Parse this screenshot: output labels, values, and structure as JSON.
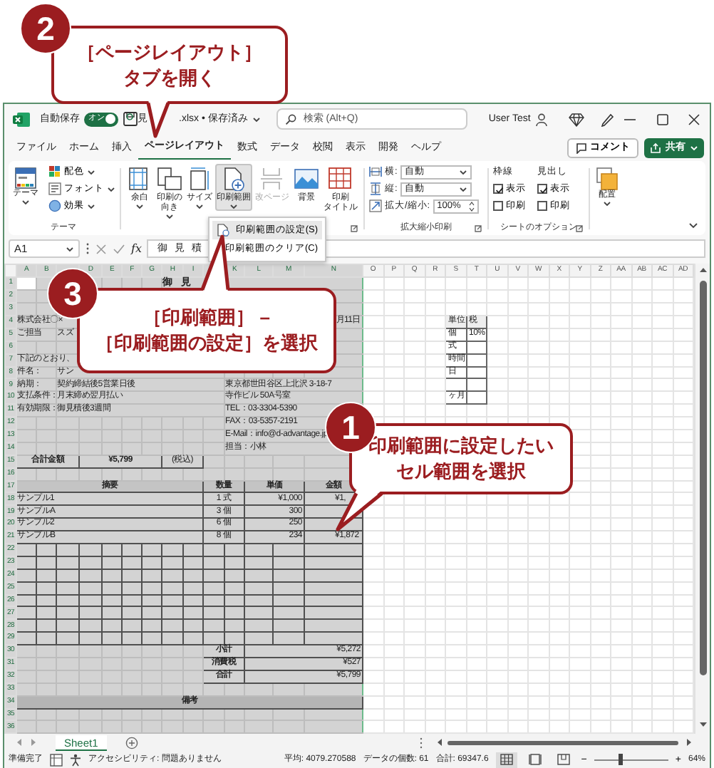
{
  "title_bar": {
    "autosave_label": "自動保存",
    "autosave": {
      "on": true,
      "label": "オン"
    },
    "file_name_start": "見",
    "file_name_end": ".xlsx • 保存済み",
    "search_placeholder": "検索 (Alt+Q)",
    "user": "User Test"
  },
  "tabs": [
    {
      "label": "ファイル",
      "selected": false
    },
    {
      "label": "ホーム",
      "selected": false
    },
    {
      "label": "挿入",
      "selected": false
    },
    {
      "label": "ページレイアウト",
      "selected": true
    },
    {
      "label": "数式",
      "selected": false
    },
    {
      "label": "データ",
      "selected": false
    },
    {
      "label": "校閲",
      "selected": false
    },
    {
      "label": "表示",
      "selected": false
    },
    {
      "label": "開発",
      "selected": false
    },
    {
      "label": "ヘルプ",
      "selected": false
    }
  ],
  "comment_button": "コメント",
  "share_button": "共有",
  "ribbon": {
    "theme_group": {
      "theme_button": "テーマ",
      "items": [
        {
          "label": "配色",
          "kind": "colors"
        },
        {
          "label": "フォント",
          "kind": "fonts"
        },
        {
          "label": "効果",
          "kind": "effects"
        }
      ],
      "label": "テーマ"
    },
    "page_setup_buttons": [
      {
        "lines": [
          "余白"
        ],
        "kind": "margins",
        "caret": true,
        "selected": false,
        "disabled": false
      },
      {
        "lines": [
          "印刷の",
          "向き"
        ],
        "kind": "orientation",
        "caret": true,
        "selected": false,
        "disabled": false
      },
      {
        "lines": [
          "サイズ"
        ],
        "kind": "size",
        "caret": true,
        "selected": false,
        "disabled": false
      },
      {
        "lines": [
          "印刷範囲"
        ],
        "kind": "print_area",
        "caret": true,
        "selected": true,
        "disabled": false
      },
      {
        "lines": [
          "改ページ"
        ],
        "kind": "breaks",
        "caret": false,
        "selected": false,
        "disabled": true
      },
      {
        "lines": [
          "背景"
        ],
        "kind": "background",
        "caret": false,
        "selected": false,
        "disabled": false
      },
      {
        "lines": [
          "印刷",
          "タイトル"
        ],
        "kind": "print_titles",
        "caret": false,
        "selected": false,
        "disabled": false
      }
    ],
    "scale_group": {
      "rows": [
        {
          "label": "横:",
          "value": "自動",
          "kind": "width"
        },
        {
          "label": "縦:",
          "value": "自動",
          "kind": "height"
        },
        {
          "label": "拡大/縮小:",
          "value": "100%",
          "kind": "scale"
        }
      ],
      "label": "拡大縮小印刷"
    },
    "sheet_options": {
      "columns": [
        {
          "title": "枠線",
          "options": [
            {
              "label": "表示",
              "checked": true
            },
            {
              "label": "印刷",
              "checked": false
            }
          ]
        },
        {
          "title": "見出し",
          "options": [
            {
              "label": "表示",
              "checked": true
            },
            {
              "label": "印刷",
              "checked": false
            }
          ]
        }
      ],
      "label": "シートのオプション"
    },
    "arrange_button": "配置"
  },
  "dropdown_menu": [
    {
      "label": "印刷範囲の設定(S)",
      "selected": true
    },
    {
      "label": "印刷範囲のクリア(C)",
      "selected": false
    }
  ],
  "formula_bar": {
    "name_box": "A1",
    "fx": "fx",
    "content": "御 見 積"
  },
  "sheet": {
    "columns": [
      "A",
      "B",
      null,
      "D",
      "E",
      "F",
      "G",
      "H",
      "I",
      null,
      "K",
      "L",
      "M",
      "N",
      "O",
      "P",
      "Q",
      "R",
      "S",
      "T",
      "U",
      "V",
      "W",
      "X",
      "Y",
      "Z",
      "AA",
      "AB",
      "AC",
      "AD"
    ],
    "rows": [
      {
        "header": "1",
        "kind": "title",
        "text": "御 見"
      },
      {
        "header": "2",
        "kind": "blank"
      },
      {
        "header": "3",
        "kind": "blank"
      },
      {
        "header": "4",
        "kind": "info",
        "left": "株式会社〇×",
        "end": "月11日"
      },
      {
        "header": "5",
        "kind": "info",
        "left": "ご担当",
        "mid": "スズ"
      },
      {
        "header": "6",
        "kind": "blank"
      },
      {
        "header": "7",
        "kind": "info",
        "left": "下記のとおり、"
      },
      {
        "header": "8",
        "kind": "info",
        "left": "件名：",
        "mid": "サン"
      },
      {
        "header": "9",
        "kind": "info",
        "left": "納期：",
        "mid": "契約締結後5営業日後",
        "right": "東京都世田谷区上北沢 3-18-7"
      },
      {
        "header": "10",
        "kind": "info",
        "left": "支払条件：",
        "mid": "月末締め翌月払い",
        "right": "寺作ビル 50A号室"
      },
      {
        "header": "11",
        "kind": "info",
        "left": "有効期限：",
        "mid": "御見積後3週間",
        "right": "TEL：03-3304-5390"
      },
      {
        "header": "12",
        "kind": "info",
        "right": "FAX：03-5357-2191"
      },
      {
        "header": "13",
        "kind": "info",
        "right": "E-Mail：info@d-advantage.jp"
      },
      {
        "header": "14",
        "kind": "info",
        "right": "担当：小林"
      },
      {
        "header": "15",
        "kind": "total",
        "total_label": "合計金額",
        "total_amount": "¥5,799",
        "tax_note": "(税込)"
      },
      {
        "header": "16",
        "kind": "blank"
      },
      {
        "header": "17",
        "kind": "head",
        "cells": [
          "摘要",
          "数量",
          "単価",
          "金額"
        ]
      },
      {
        "header": "18",
        "kind": "item",
        "cells": {
          "description": "サンプル1",
          "quantity": "1 式",
          "price": "¥1,000",
          "amount": "¥1,"
        }
      },
      {
        "header": "19",
        "kind": "item",
        "cells": {
          "description": "サンプルA",
          "quantity": "3 個",
          "price": "300"
        }
      },
      {
        "header": "20",
        "kind": "item",
        "cells": {
          "description": "サンプル2",
          "quantity": "6 個",
          "price": "250"
        }
      },
      {
        "header": "21",
        "kind": "item",
        "cells": {
          "description": "サンプルB",
          "quantity": "8 個",
          "price": "234",
          "amount": "¥1,872"
        }
      },
      {
        "header": "22",
        "kind": "item"
      },
      {
        "header": "23",
        "kind": "item"
      },
      {
        "header": "24",
        "kind": "item"
      },
      {
        "header": "25",
        "kind": "item"
      },
      {
        "header": "26",
        "kind": "item"
      },
      {
        "header": "27",
        "kind": "item"
      },
      {
        "header": "28",
        "kind": "item"
      },
      {
        "header": "29",
        "kind": "item"
      },
      {
        "header": "30",
        "kind": "sum",
        "label": "小計",
        "amount": "¥5,272"
      },
      {
        "header": "31",
        "kind": "sum",
        "label": "消費税",
        "amount": "¥527"
      },
      {
        "header": "32",
        "kind": "sum",
        "label": "合計",
        "amount": "¥5,799"
      },
      {
        "header": "33",
        "kind": "blank"
      },
      {
        "header": "34",
        "kind": "note",
        "text": "備考"
      },
      {
        "header": "35",
        "kind": "blank"
      },
      {
        "header": "36",
        "kind": "blank"
      }
    ],
    "side_table": [
      {
        "unit": "単位",
        "tax": "税",
        "kind": "head"
      },
      {
        "unit": "個",
        "tax": "10%",
        "kind": "row"
      },
      {
        "unit": "式",
        "kind": "row"
      },
      {
        "unit": "時間",
        "kind": "row"
      },
      {
        "unit": "日",
        "kind": "row"
      },
      {
        "kind": "row"
      },
      {
        "unit": "ヶ月",
        "kind": "row"
      }
    ]
  },
  "sheet_tabs": [
    {
      "label": "Sheet1",
      "selected": true
    }
  ],
  "status_bar": {
    "ready": "準備完了",
    "accessibility": "アクセシビリティ: 問題ありません",
    "average": "平均: 4079.270588",
    "count": "データの個数: 61",
    "sum": "合計: 69347.6",
    "views": [
      {
        "kind": "normal",
        "selected": true
      },
      {
        "kind": "page_layout",
        "selected": false
      },
      {
        "kind": "page_break",
        "selected": false
      }
    ],
    "zoom": {
      "out": "−",
      "in": "+",
      "level": 0.35,
      "reading": "64%"
    }
  },
  "callouts": [
    {
      "number": "2",
      "lines": [
        "［ページレイアウト］",
        "タブを開く"
      ]
    },
    {
      "number": "3",
      "lines": [
        "［印刷範囲］ –",
        "［印刷範囲の設定］を選択"
      ]
    },
    {
      "number": "1",
      "lines": [
        "印刷範囲に設定したい",
        "セル範囲を選択"
      ]
    }
  ]
}
